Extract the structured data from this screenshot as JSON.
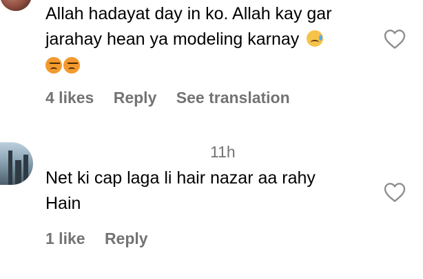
{
  "comments": [
    {
      "text_line1": "Allah hadayat day in ko. Allah kay gar",
      "text_line2": "jarahay hean ya modeling karnay",
      "emojis": [
        "sad-but-relieved-face",
        "angry-face",
        "angry-face"
      ],
      "likes": "4 likes",
      "reply": "Reply",
      "translate": "See translation"
    },
    {
      "timestamp": "11h",
      "text_line1": "Net ki cap laga li hair nazar aa rahy",
      "text_line2": "Hain",
      "likes": "1 like",
      "reply": "Reply"
    }
  ],
  "colors": {
    "text": "#000000",
    "secondary": "#737373",
    "heart_outline": "#8e8e8e"
  },
  "icons": {
    "like": "heart-outline-icon"
  }
}
